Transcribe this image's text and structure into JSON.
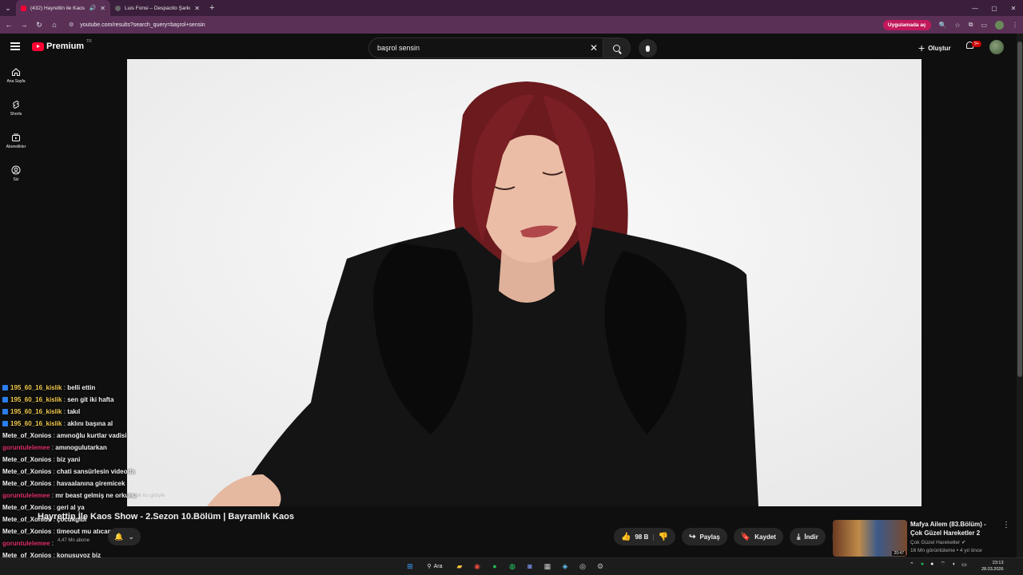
{
  "browser": {
    "tabs": [
      {
        "title": "(432) Hayrettin ile Kaos Sh",
        "active": true,
        "audio": true
      },
      {
        "title": "Luis Fonsi – Despacito Şarkı Sö",
        "active": false,
        "audio": false
      }
    ],
    "url": "youtube.com/results?search_query=başrol+sensin",
    "open_in_app": "Uygulamada aç"
  },
  "yt": {
    "logo": "Premium",
    "logo_region": "TR",
    "search_value": "başrol sensin",
    "create_label": "Oluştur",
    "notif_count": "9+"
  },
  "sidebar": {
    "items": [
      {
        "label": "Ana Sayfa",
        "icon": "home-icon"
      },
      {
        "label": "Shorts",
        "icon": "shorts-icon"
      },
      {
        "label": "Abonelikler",
        "icon": "subscriptions-icon"
      },
      {
        "label": "Siz",
        "icon": "you-icon"
      }
    ]
  },
  "chat": {
    "messages": [
      {
        "user": "195_60_16_kislik",
        "text": "belli ettin",
        "color": "y",
        "badge": true
      },
      {
        "user": "195_60_16_kislik",
        "text": "sen git iki hafta",
        "color": "y",
        "badge": true
      },
      {
        "user": "195_60_16_kislik",
        "text": "takıl",
        "color": "y",
        "badge": true
      },
      {
        "user": "195_60_16_kislik",
        "text": "aklını başına al",
        "color": "y",
        "badge": true
      },
      {
        "user": "Mete_of_Xonios",
        "text": "amınoğlu kurtlar vadisi",
        "color": "w",
        "badge": false
      },
      {
        "user": "goruntulelemee",
        "text": "amınogulutarkan",
        "color": "r",
        "badge": false
      },
      {
        "user": "Mete_of_Xonios",
        "text": "biz yani",
        "color": "w",
        "badge": false
      },
      {
        "user": "Mete_of_Xonios",
        "text": "chati sansürlesin videoda",
        "color": "w",
        "badge": false
      },
      {
        "user": "Mete_of_Xonios",
        "text": "havaalanına giremicek",
        "color": "w",
        "badge": false
      },
      {
        "user": "goruntulelemee",
        "text": "mr beast gelmiş ne orkunu",
        "color": "r",
        "badge": false
      },
      {
        "user": "Mete_of_Xonios",
        "text": "geri al ya",
        "color": "w",
        "badge": false
      },
      {
        "user": "Mete_of_Xonios",
        "text": "çöcukgibi",
        "color": "w",
        "badge": false
      },
      {
        "user": "Mete_of_Xonios",
        "text": "timeout mu atıcan",
        "color": "w",
        "badge": false
      },
      {
        "user": "goruntulelemee",
        "text": "",
        "color": "r",
        "badge": false
      },
      {
        "user": "Mete_of_Xonios",
        "text": "konuşuyoz biz",
        "color": "w",
        "badge": false
      }
    ],
    "overlay_text": "cocuk bu gidiyle"
  },
  "video": {
    "title": "Hayrettin İle Kaos Show - 2.Sezon 10.Bölüm | Bayramlık Kaos",
    "sub_count": "4,47 Mn abone"
  },
  "actions": {
    "like_count": "98 B",
    "share": "Paylaş",
    "save": "Kaydet",
    "download": "İndir"
  },
  "recommended": {
    "title": "Mafya Ailem (83.Bölüm) - Çok Güzel Hareketler 2",
    "channel": "Çok Güzel Hareketler",
    "meta": "16 Mn görüntüleme • 4 yıl önce",
    "duration": "20:47"
  },
  "taskbar": {
    "search": "Ara",
    "time": "23:13",
    "date": "28.03.2026"
  }
}
